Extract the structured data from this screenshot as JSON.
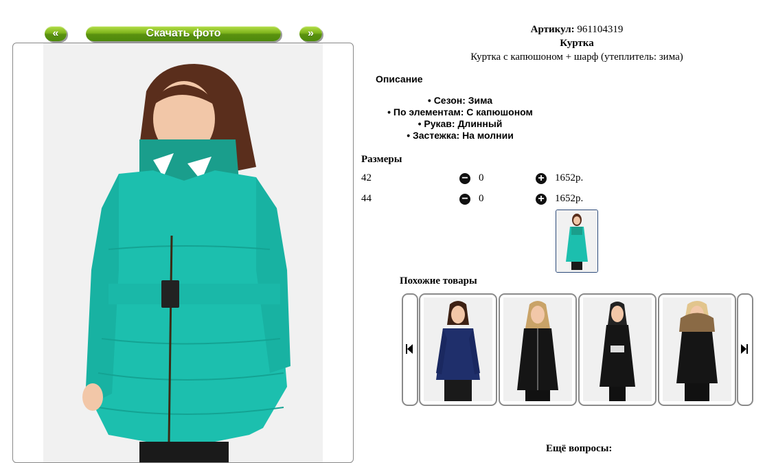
{
  "nav": {
    "prev_label": "«",
    "download_label": "Скачать фото",
    "next_label": "»"
  },
  "product": {
    "article_label": "Артикул:",
    "article_value": "961104319",
    "name": "Куртка",
    "description": "Куртка с капюшоном + шарф (утеплитель: зима)"
  },
  "description": {
    "heading": "Описание",
    "items": [
      "Сезон: Зима",
      "По элементам: С капюшоном",
      "Рукав: Длинный",
      "Застежка: На молнии"
    ]
  },
  "sizes": {
    "heading": "Размеры",
    "rows": [
      {
        "size": "42",
        "qty": "0",
        "price": "1652р."
      },
      {
        "size": "44",
        "qty": "0",
        "price": "1652р."
      }
    ]
  },
  "similar": {
    "heading": "Похожие товары"
  },
  "bottom_text": "Ещё вопросы:",
  "colors": {
    "accent_green": "#6aa317",
    "jacket_teal": "#1cbfae",
    "navy_jacket": "#1f2f6b",
    "black_jacket": "#151515"
  },
  "icons": {
    "minus": "minus-circle-icon",
    "plus": "plus-circle-icon",
    "carousel_prev": "skip-back-icon",
    "carousel_next": "skip-forward-icon"
  }
}
